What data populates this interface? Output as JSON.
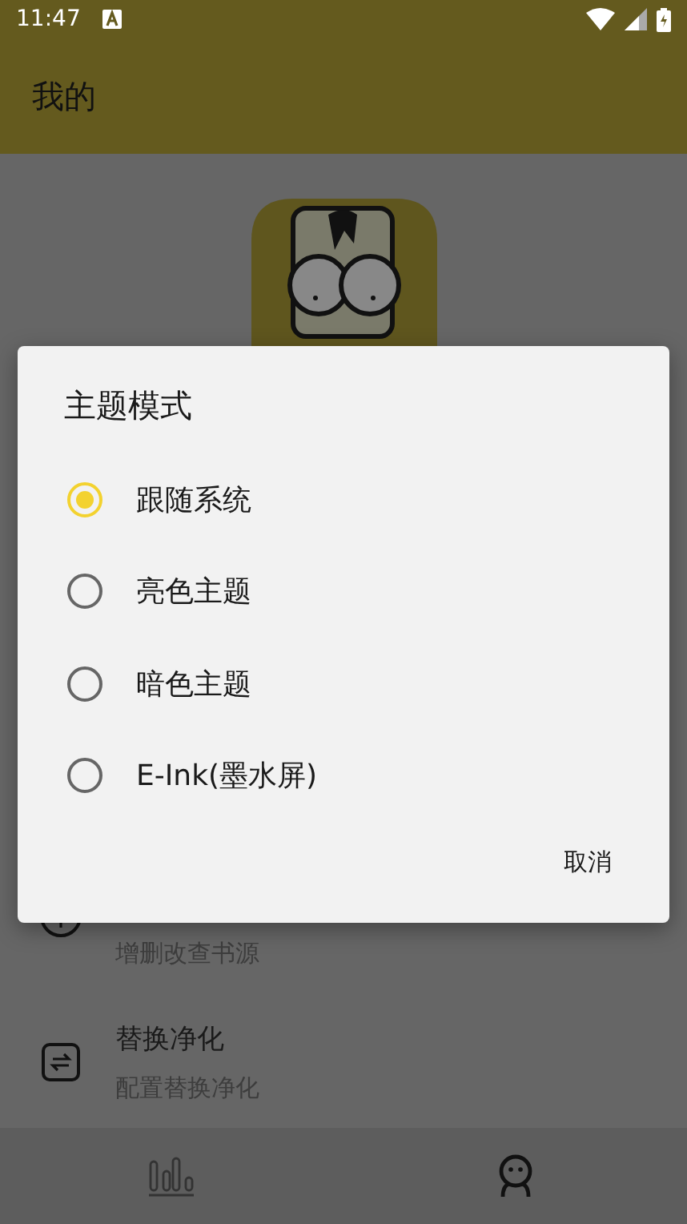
{
  "status_bar": {
    "time": "11:47"
  },
  "app_bar": {
    "title": "我的"
  },
  "list_items": [
    {
      "kind": "book",
      "subtitle": "增删改查书源"
    },
    {
      "kind": "replace",
      "title": "替换净化",
      "subtitle": "配置替换净化"
    }
  ],
  "bottom_nav": [
    {
      "kind": "bookshelf",
      "selected": false
    },
    {
      "kind": "profile",
      "selected": true
    }
  ],
  "dialog": {
    "title": "主题模式",
    "options": [
      {
        "label": "跟随系统",
        "selected": true
      },
      {
        "label": "亮色主题",
        "selected": false
      },
      {
        "label": "暗色主题",
        "selected": false
      },
      {
        "label": "E-Ink(墨水屏)",
        "selected": false
      }
    ],
    "buttons": [
      "取消"
    ]
  }
}
